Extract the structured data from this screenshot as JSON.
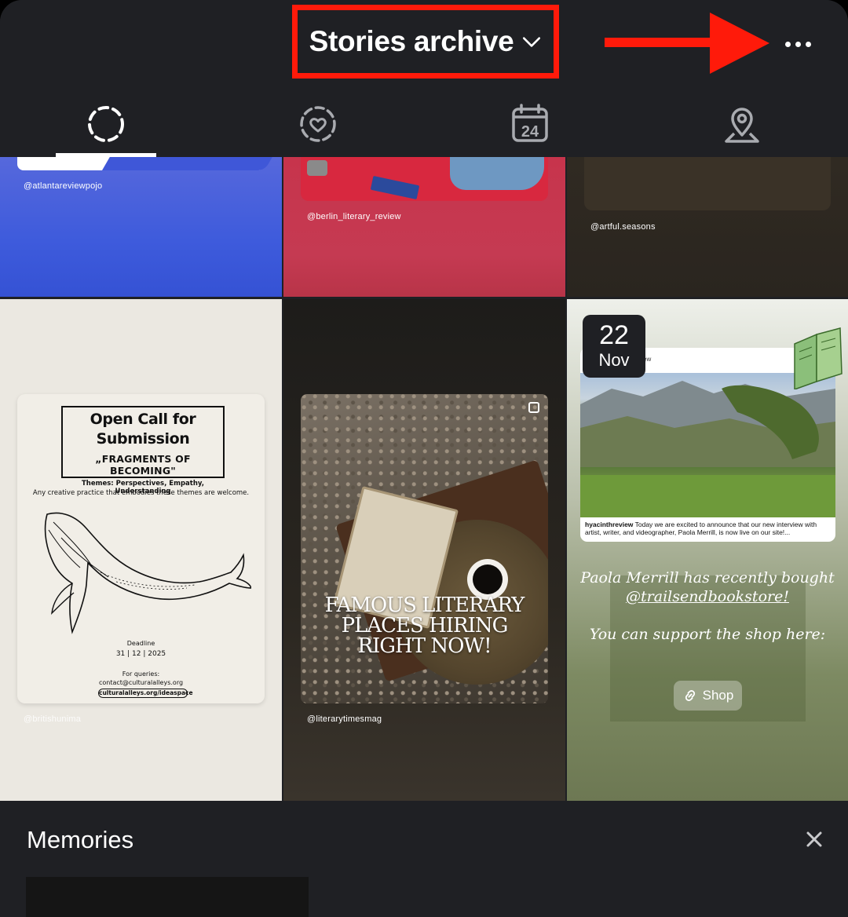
{
  "header": {
    "title": "Stories archive",
    "more_icon": "more-horizontal-icon",
    "annotation_color": "#ff1a0a"
  },
  "tabs": [
    {
      "name": "Stories archive",
      "icon": "dashed-circle-icon",
      "active": true
    },
    {
      "name": "Highlights",
      "icon": "heart-circle-icon",
      "active": false
    },
    {
      "name": "Calendar",
      "icon": "calendar-24-icon",
      "active": false,
      "label": "24"
    },
    {
      "name": "Map",
      "icon": "location-pin-icon",
      "active": false
    }
  ],
  "grid": {
    "row1": [
      {
        "handle": "@atlantareviewpojo",
        "color": "#3e5bdc"
      },
      {
        "handle": "@berlin_literary_review",
        "color": "#c53a52"
      },
      {
        "handle": "@artful.seasons",
        "color": "#2a251f"
      }
    ],
    "open_call": {
      "title_line1": "Open Call for",
      "title_line2": "Submission",
      "subtitle": "„FRAGMENTS OF BECOMING\"",
      "themes": "Themes: Perspectives, Empathy, Understanding",
      "body": "Any creative practice that embodies these themes are welcome.",
      "deadline_label": "Deadline",
      "deadline": "31 | 12 | 2025",
      "queries_label": "For queries:",
      "contact": "contact@culturalalleys.org",
      "link": "culturalalleys.org/ideaspace",
      "handle": "@britishunima"
    },
    "literary": {
      "headline_line1": "FAMOUS LITERARY",
      "headline_line2": "PLACES HIRING",
      "headline_line3": "RIGHT NOW!",
      "handle": "@literarytimesmag"
    },
    "paola": {
      "date_day": "22",
      "date_month": "Nov",
      "header_fragment": "ew",
      "caption_user": "hyacinthreview",
      "caption_text": " Today we are excited to announce that our new interview with artist, writer, and videographer, Paola Merrill, is now live on our site!...",
      "line1": "Paola Merrill has recently bought",
      "line2": "@trailsendbookstore!",
      "line3": "You can support the shop here:",
      "shop_label": "Shop"
    }
  },
  "memories": {
    "title": "Memories",
    "close_icon": "close-icon"
  }
}
